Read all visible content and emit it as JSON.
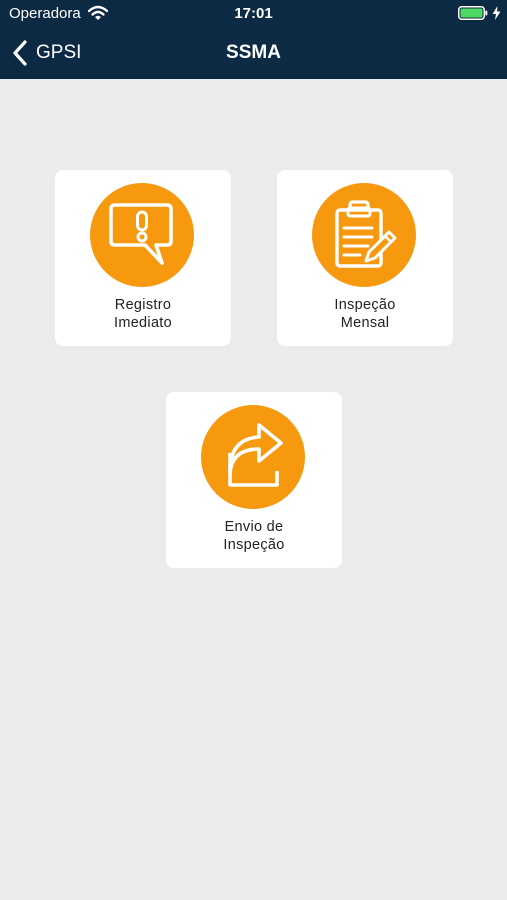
{
  "status_bar": {
    "carrier": "Operadora",
    "time": "17:01"
  },
  "nav": {
    "back_label": "GPSI",
    "title": "SSMA"
  },
  "tiles": [
    {
      "line1": "Registro",
      "line2": "Imediato",
      "icon": "alert-message-icon"
    },
    {
      "line1": "Inspeção",
      "line2": "Mensal",
      "icon": "clipboard-edit-icon"
    },
    {
      "line1": "Envio de",
      "line2": "Inspeção",
      "icon": "share-arrow-icon"
    }
  ],
  "colors": {
    "header": "#0d2a45",
    "accent": "#f7990f",
    "background": "#ebebeb",
    "battery": "#4cd964"
  }
}
